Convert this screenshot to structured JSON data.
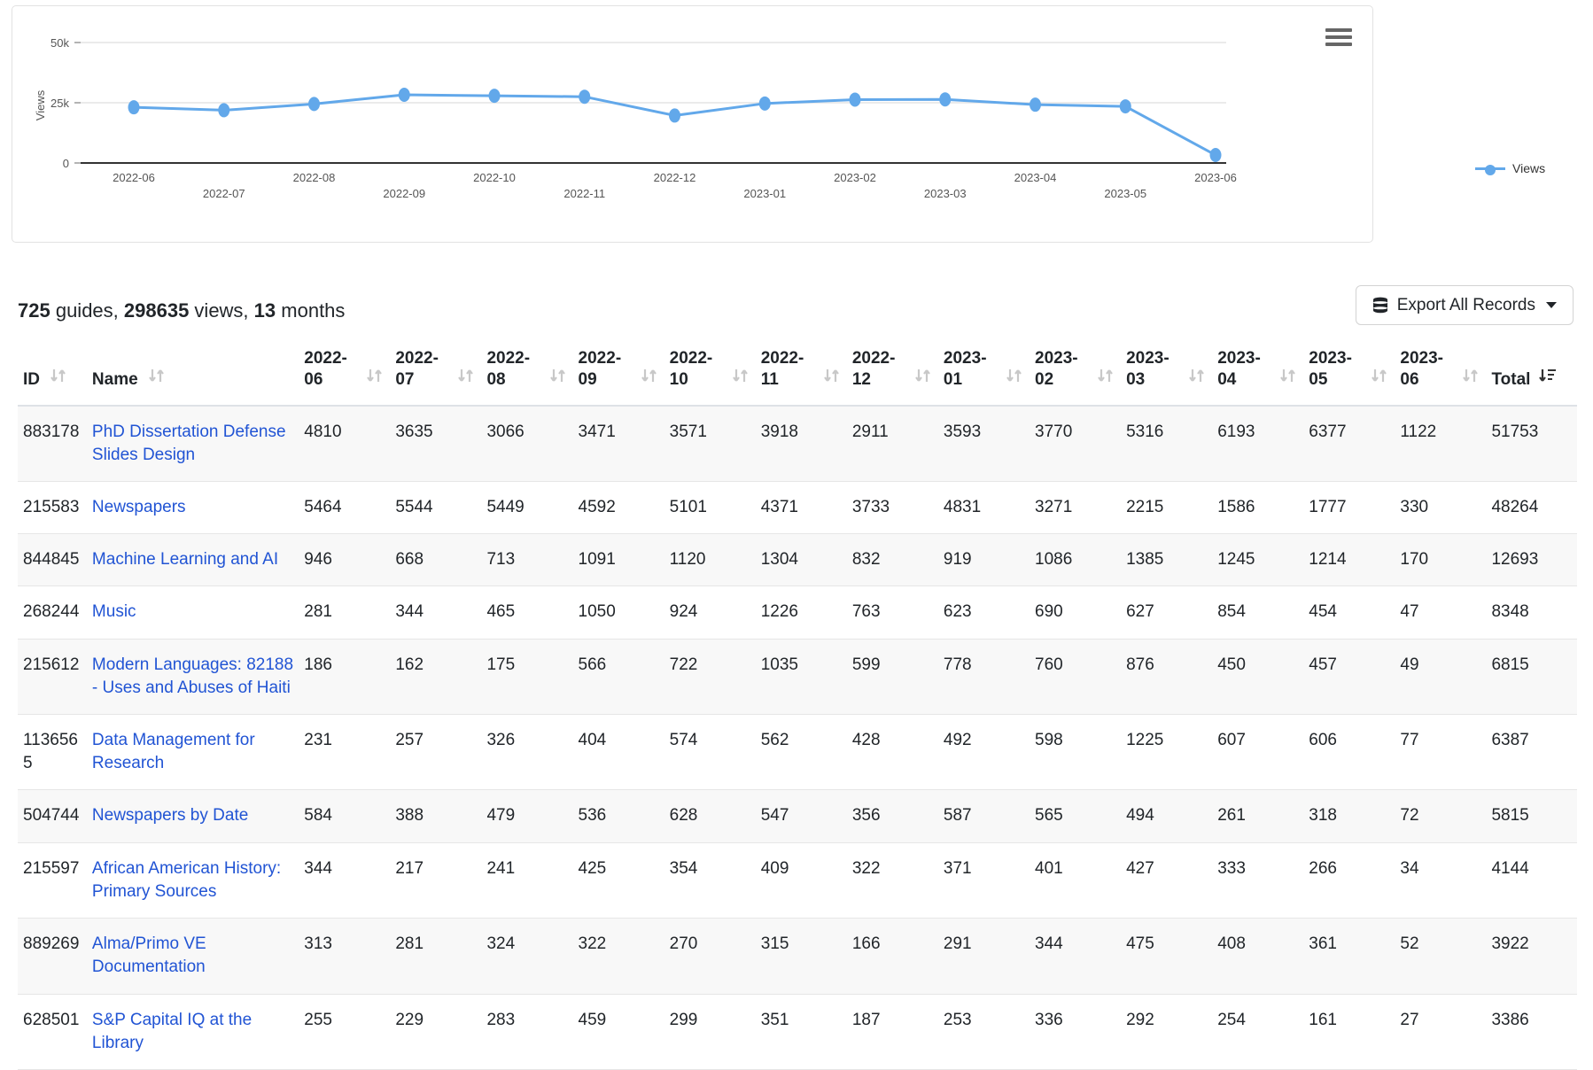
{
  "chart_data": {
    "type": "line",
    "title": "",
    "xlabel": "",
    "ylabel": "Views",
    "ylim": [
      0,
      50000
    ],
    "ytick_labels": [
      "0",
      "25k",
      "50k"
    ],
    "ytick_values": [
      0,
      25000,
      50000
    ],
    "grid": true,
    "legend_position": "right",
    "categories": [
      "2022-06",
      "2022-07",
      "2022-08",
      "2022-09",
      "2022-10",
      "2022-11",
      "2022-12",
      "2023-01",
      "2023-02",
      "2023-03",
      "2023-04",
      "2023-05",
      "2023-06"
    ],
    "series": [
      {
        "name": "Views",
        "color": "#62A8EA",
        "values": [
          23100,
          21900,
          24500,
          28300,
          27900,
          27500,
          19700,
          24700,
          26300,
          26400,
          24200,
          23500,
          3300
        ]
      }
    ]
  },
  "chart_card": {
    "menu_icon": "hamburger-menu-icon",
    "legend_label": "Views"
  },
  "summary": {
    "guides_count": "725",
    "guides_label": " guides, ",
    "views_count": "298635",
    "views_label": " views, ",
    "months_count": "13",
    "months_label": " months"
  },
  "toolbar": {
    "export_label": "Export All Records",
    "export_icon": "database-stack-icon",
    "export_caret": "caret-down-icon"
  },
  "table": {
    "columns": [
      {
        "key": "id",
        "label": "ID",
        "sort": "inactive"
      },
      {
        "key": "name",
        "label": "Name",
        "sort": "inactive"
      },
      {
        "key": "m1",
        "label": "2022-06",
        "sort": "inactive"
      },
      {
        "key": "m2",
        "label": "2022-07",
        "sort": "inactive"
      },
      {
        "key": "m3",
        "label": "2022-08",
        "sort": "inactive"
      },
      {
        "key": "m4",
        "label": "2022-09",
        "sort": "inactive"
      },
      {
        "key": "m5",
        "label": "2022-10",
        "sort": "inactive"
      },
      {
        "key": "m6",
        "label": "2022-11",
        "sort": "inactive"
      },
      {
        "key": "m7",
        "label": "2022-12",
        "sort": "inactive"
      },
      {
        "key": "m8",
        "label": "2023-01",
        "sort": "inactive"
      },
      {
        "key": "m9",
        "label": "2023-02",
        "sort": "inactive"
      },
      {
        "key": "m10",
        "label": "2023-03",
        "sort": "inactive"
      },
      {
        "key": "m11",
        "label": "2023-04",
        "sort": "inactive"
      },
      {
        "key": "m12",
        "label": "2023-05",
        "sort": "inactive"
      },
      {
        "key": "m13",
        "label": "2023-06",
        "sort": "inactive"
      },
      {
        "key": "total",
        "label": "Total",
        "sort": "desc"
      }
    ],
    "rows": [
      {
        "id": "883178",
        "name": "PhD Dissertation Defense Slides Design",
        "values": [
          "4810",
          "3635",
          "3066",
          "3471",
          "3571",
          "3918",
          "2911",
          "3593",
          "3770",
          "5316",
          "6193",
          "6377",
          "1122"
        ],
        "total": "51753"
      },
      {
        "id": "215583",
        "name": "Newspapers",
        "values": [
          "5464",
          "5544",
          "5449",
          "4592",
          "5101",
          "4371",
          "3733",
          "4831",
          "3271",
          "2215",
          "1586",
          "1777",
          "330"
        ],
        "total": "48264"
      },
      {
        "id": "844845",
        "name": "Machine Learning and AI",
        "values": [
          "946",
          "668",
          "713",
          "1091",
          "1120",
          "1304",
          "832",
          "919",
          "1086",
          "1385",
          "1245",
          "1214",
          "170"
        ],
        "total": "12693"
      },
      {
        "id": "268244",
        "name": "Music",
        "values": [
          "281",
          "344",
          "465",
          "1050",
          "924",
          "1226",
          "763",
          "623",
          "690",
          "627",
          "854",
          "454",
          "47"
        ],
        "total": "8348"
      },
      {
        "id": "215612",
        "name": "Modern Languages: 82188 - Uses and Abuses of Haiti",
        "values": [
          "186",
          "162",
          "175",
          "566",
          "722",
          "1035",
          "599",
          "778",
          "760",
          "876",
          "450",
          "457",
          "49"
        ],
        "total": "6815"
      },
      {
        "id": "1136565",
        "name": "Data Management for Research",
        "values": [
          "231",
          "257",
          "326",
          "404",
          "574",
          "562",
          "428",
          "492",
          "598",
          "1225",
          "607",
          "606",
          "77"
        ],
        "total": "6387"
      },
      {
        "id": "504744",
        "name": "Newspapers by Date",
        "values": [
          "584",
          "388",
          "479",
          "536",
          "628",
          "547",
          "356",
          "587",
          "565",
          "494",
          "261",
          "318",
          "72"
        ],
        "total": "5815"
      },
      {
        "id": "215597",
        "name": "African American History: Primary Sources",
        "values": [
          "344",
          "217",
          "241",
          "425",
          "354",
          "409",
          "322",
          "371",
          "401",
          "427",
          "333",
          "266",
          "34"
        ],
        "total": "4144"
      },
      {
        "id": "889269",
        "name": "Alma/Primo VE Documentation",
        "values": [
          "313",
          "281",
          "324",
          "322",
          "270",
          "315",
          "166",
          "291",
          "344",
          "475",
          "408",
          "361",
          "52"
        ],
        "total": "3922"
      },
      {
        "id": "628501",
        "name": "S&P Capital IQ at the Library",
        "values": [
          "255",
          "229",
          "283",
          "459",
          "299",
          "351",
          "187",
          "253",
          "336",
          "292",
          "254",
          "161",
          "27"
        ],
        "total": "3386"
      }
    ]
  },
  "colors": {
    "series": "#62A8EA",
    "link": "#2154d4",
    "stripe": "#f8f8f8",
    "grid": "#ebebeb",
    "axis": "#333333"
  }
}
